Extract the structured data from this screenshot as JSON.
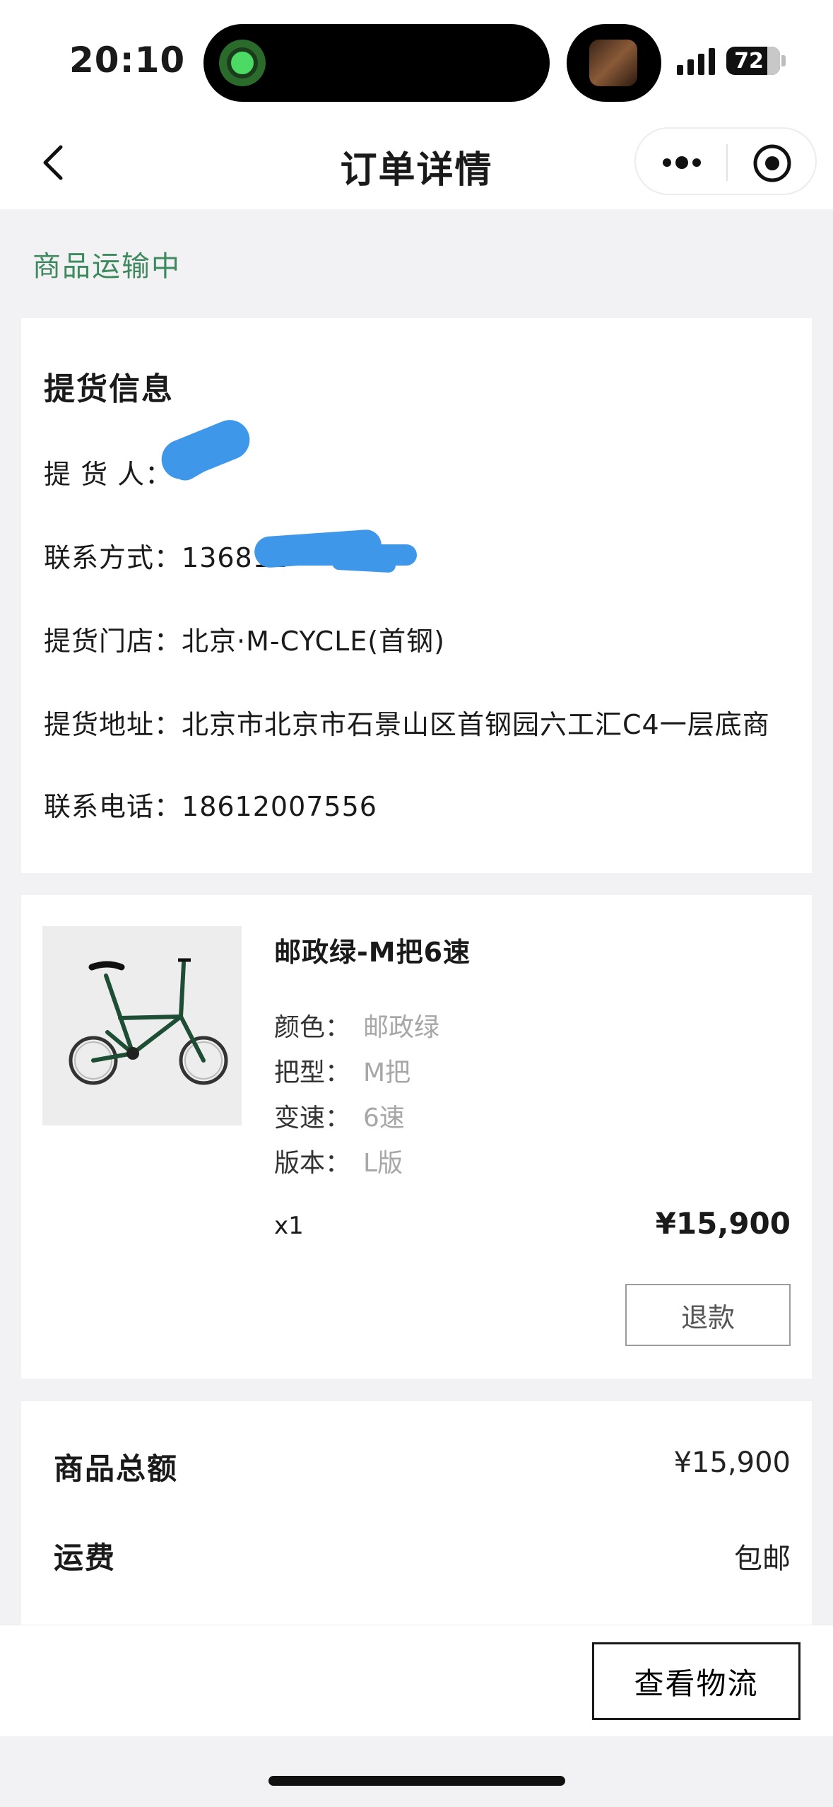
{
  "status_bar": {
    "time": "20:10",
    "battery": "72"
  },
  "nav": {
    "title": "订单详情"
  },
  "order_status": "商品运输中",
  "pickup": {
    "title": "提货信息",
    "rows": [
      {
        "label": "提 货 人：",
        "value": ""
      },
      {
        "label": "联系方式：",
        "value": "136812"
      },
      {
        "label": "提货门店：",
        "value": "北京·M-CYCLE(首钢)"
      },
      {
        "label": "提货地址：",
        "value": "北京市北京市石景山区首钢园六工汇C4一层底商"
      },
      {
        "label": "联系电话：",
        "value": "18612007556"
      }
    ]
  },
  "product": {
    "name": "邮政绿-M把6速",
    "image_icon": "bicycle-image",
    "specs": [
      {
        "label": "颜色：",
        "value": "邮政绿"
      },
      {
        "label": "把型：",
        "value": "M把"
      },
      {
        "label": "变速：",
        "value": "6速"
      },
      {
        "label": "版本：",
        "value": "L版"
      }
    ],
    "quantity": "x1",
    "price": "¥15,900",
    "refund_label": "退款"
  },
  "summary": {
    "total_label": "商品总额",
    "total_value": "¥15,900",
    "shipping_label": "运费",
    "shipping_value": "包邮"
  },
  "bottom": {
    "logistics_label": "查看物流"
  },
  "colors": {
    "status_green": "#3e8a5e",
    "redaction_blue": "#3f97ea"
  }
}
